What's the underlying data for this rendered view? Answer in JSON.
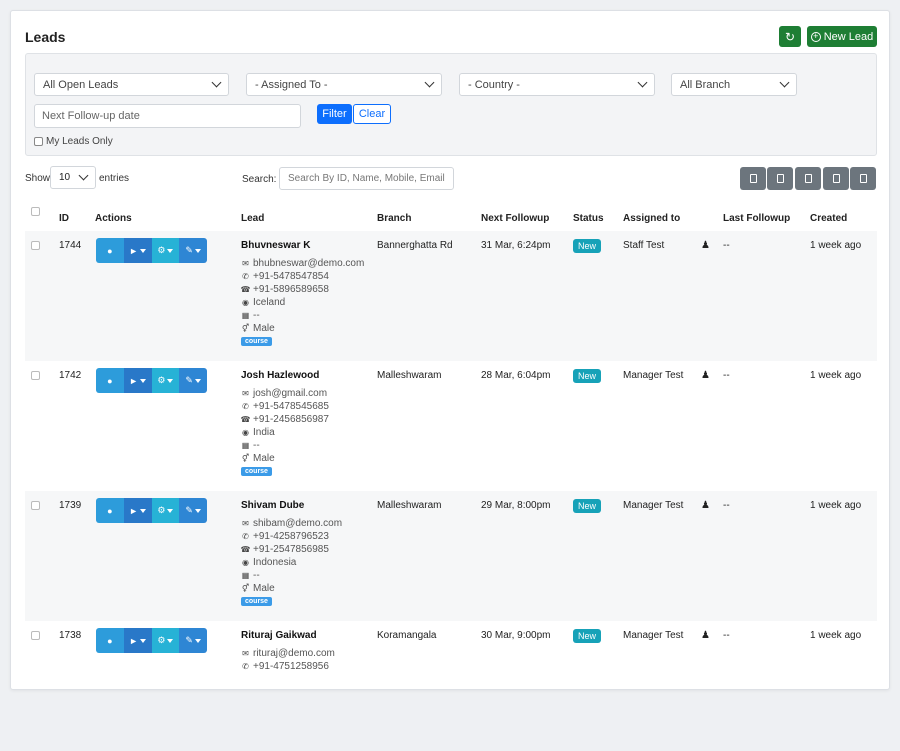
{
  "page": {
    "title": "Leads"
  },
  "toolbar": {
    "refresh_icon": "refresh-icon",
    "new_lead_label": "New Lead"
  },
  "filters": {
    "lead_scope": "All Open Leads",
    "assigned_to": "- Assigned To -",
    "country": "- Country -",
    "branch": "All Branch",
    "followup_placeholder": "Next Follow-up date",
    "filter_label": "Filter",
    "clear_label": "Clear",
    "my_leads_label": "My Leads Only"
  },
  "table_controls": {
    "show_label": "Show",
    "entries_value": "10",
    "entries_label": "entries",
    "search_label": "Search:",
    "search_placeholder": "Search By ID, Name, Mobile, Email"
  },
  "columns": [
    "ID",
    "Actions",
    "Lead",
    "Branch",
    "Next Followup",
    "Status",
    "Assigned to",
    "Last Followup",
    "Created"
  ],
  "rows": [
    {
      "id": "1744",
      "name": "Bhuvneswar K",
      "email": "bhubneswar@demo.com",
      "phone": "+91-5478547854",
      "whatsapp": "+91-5896589658",
      "country": "Iceland",
      "company": "--",
      "gender": "Male",
      "tag": "course",
      "branch": "Bannerghatta Rd",
      "next_followup": "31 Mar, 6:24pm",
      "status": "New",
      "assigned_to": "Staff Test",
      "last_followup": "--",
      "created": "1 week ago"
    },
    {
      "id": "1742",
      "name": "Josh Hazlewood",
      "email": "josh@gmail.com",
      "phone": "+91-5478545685",
      "whatsapp": "+91-2456856987",
      "country": "India",
      "company": "--",
      "gender": "Male",
      "tag": "course",
      "branch": "Malleshwaram",
      "next_followup": "28 Mar, 6:04pm",
      "status": "New",
      "assigned_to": "Manager Test",
      "last_followup": "--",
      "created": "1 week ago"
    },
    {
      "id": "1739",
      "name": "Shivam Dube",
      "email": "shibam@demo.com",
      "phone": "+91-4258796523",
      "whatsapp": "+91-2547856985",
      "country": "Indonesia",
      "company": "--",
      "gender": "Male",
      "tag": "course",
      "branch": "Malleshwaram",
      "next_followup": "29 Mar, 8:00pm",
      "status": "New",
      "assigned_to": "Manager Test",
      "last_followup": "--",
      "created": "1 week ago"
    },
    {
      "id": "1738",
      "name": "Rituraj Gaikwad",
      "email": "rituraj@demo.com",
      "phone": "+91-4751258956",
      "whatsapp": "",
      "country": "",
      "company": "",
      "gender": "",
      "tag": "",
      "branch": "Koramangala",
      "next_followup": "30 Mar, 9:00pm",
      "status": "New",
      "assigned_to": "Manager Test",
      "last_followup": "--",
      "created": "1 week ago"
    }
  ],
  "colors": {
    "green": "#1e7e34",
    "blue": "#0d6efd",
    "status_new": "#17a2b8",
    "export_gray": "#6c757d"
  }
}
